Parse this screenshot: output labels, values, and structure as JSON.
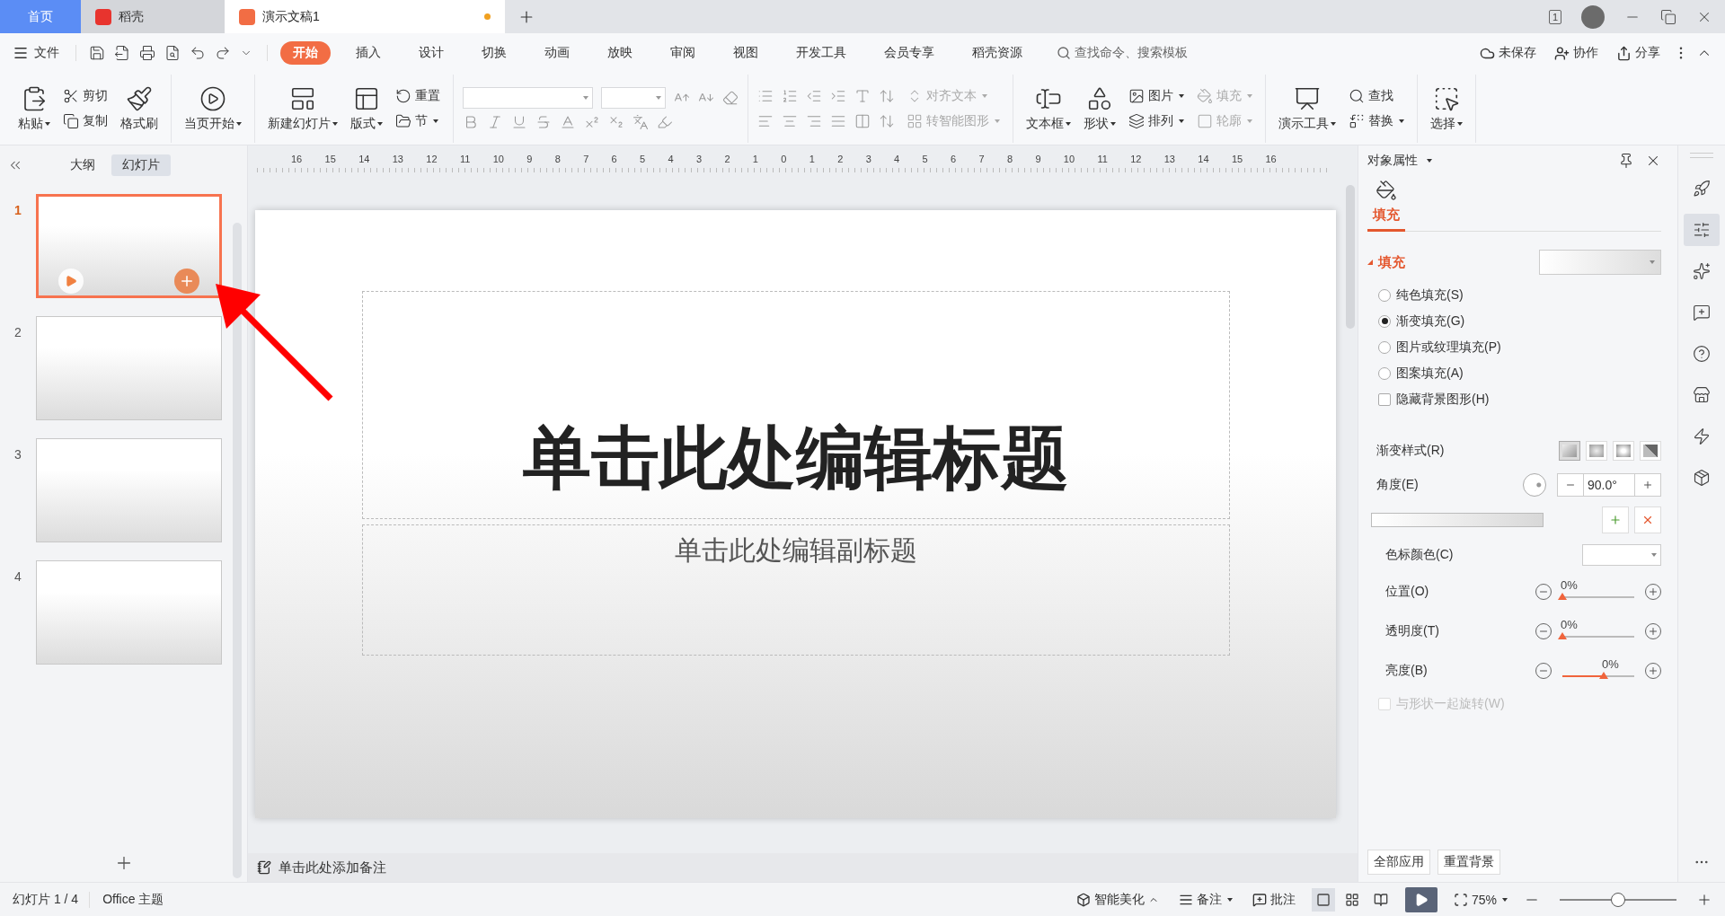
{
  "title_bar": {
    "tabs": [
      {
        "label": "首页",
        "kind": "home",
        "selected": false
      },
      {
        "label": "稻壳",
        "kind": "app",
        "selected": false
      },
      {
        "label": "演示文稿1",
        "kind": "doc",
        "selected": true,
        "modified": true
      }
    ],
    "device_badge": "1"
  },
  "menu_bar": {
    "file": "文件",
    "tabs": [
      {
        "label": "开始",
        "selected": true
      },
      {
        "label": "插入",
        "selected": false
      },
      {
        "label": "设计",
        "selected": false
      },
      {
        "label": "切换",
        "selected": false
      },
      {
        "label": "动画",
        "selected": false
      },
      {
        "label": "放映",
        "selected": false
      },
      {
        "label": "审阅",
        "selected": false
      },
      {
        "label": "视图",
        "selected": false
      },
      {
        "label": "开发工具",
        "selected": false
      },
      {
        "label": "会员专享",
        "selected": false
      },
      {
        "label": "稻壳资源",
        "selected": false
      }
    ],
    "search": {
      "placeholder": "查找命令、搜索模板"
    },
    "actions": [
      "未保存",
      "协作",
      "分享"
    ]
  },
  "ribbon": {
    "paste": {
      "label": "粘贴",
      "dropdown": true,
      "disabled": false
    },
    "cut": {
      "label": "剪切",
      "dropdown": false,
      "disabled": false
    },
    "copy": {
      "label": "复制",
      "dropdown": false,
      "disabled": false
    },
    "format_painter": {
      "label": "格式刷",
      "dropdown": false,
      "disabled": false
    },
    "play_current": {
      "label": "当页开始",
      "dropdown": true,
      "disabled": false
    },
    "new_slide": {
      "label": "新建幻灯片",
      "dropdown": true,
      "disabled": false
    },
    "layout": {
      "label": "版式",
      "dropdown": true,
      "disabled": false
    },
    "reset": {
      "label": "重置",
      "dropdown": false,
      "disabled": false
    },
    "section": {
      "label": "节",
      "dropdown": true,
      "disabled": false
    },
    "align_text": {
      "label": "对齐文本",
      "dropdown": true,
      "disabled": true
    },
    "smart_art": {
      "label": "转智能图形",
      "dropdown": true,
      "disabled": true
    },
    "text_box": {
      "label": "文本框",
      "dropdown": true,
      "disabled": false
    },
    "shape": {
      "label": "形状",
      "dropdown": true,
      "disabled": false
    },
    "picture": {
      "label": "图片",
      "dropdown": true,
      "disabled": false
    },
    "arrange": {
      "label": "排列",
      "dropdown": true,
      "disabled": false
    },
    "fill": {
      "label": "填充",
      "dropdown": true,
      "disabled": true
    },
    "outline": {
      "label": "轮廓",
      "dropdown": true,
      "disabled": true
    },
    "tools": {
      "label": "演示工具",
      "dropdown": true,
      "disabled": false
    },
    "find": {
      "label": "查找",
      "dropdown": false,
      "disabled": false
    },
    "replace": {
      "label": "替换",
      "dropdown": true,
      "disabled": false
    },
    "select": {
      "label": "选择",
      "dropdown": true,
      "disabled": false
    }
  },
  "slide_panel": {
    "views": [
      {
        "label": "大纲",
        "selected": false
      },
      {
        "label": "幻灯片",
        "selected": true
      }
    ],
    "slides": [
      {
        "number": "1",
        "selected": true
      },
      {
        "number": "2",
        "selected": false
      },
      {
        "number": "3",
        "selected": false
      },
      {
        "number": "4",
        "selected": false
      }
    ]
  },
  "ruler": [
    "16",
    "15",
    "14",
    "13",
    "12",
    "11",
    "10",
    "9",
    "8",
    "7",
    "6",
    "5",
    "4",
    "3",
    "2",
    "1",
    "0",
    "1",
    "2",
    "3",
    "4",
    "5",
    "6",
    "7",
    "8",
    "9",
    "10",
    "11",
    "12",
    "13",
    "14",
    "15",
    "16"
  ],
  "slide": {
    "title": "单击此处编辑标题",
    "subtitle": "单击此处编辑副标题"
  },
  "notes": {
    "placeholder": "单击此处添加备注"
  },
  "properties": {
    "title": "对象属性",
    "tab": {
      "label": "填充",
      "selected": true
    },
    "section": "填充",
    "options": [
      {
        "label": "纯色填充(S)",
        "kind": "radio",
        "selected": false
      },
      {
        "label": "渐变填充(G)",
        "kind": "radio",
        "selected": true
      },
      {
        "label": "图片或纹理填充(P)",
        "kind": "radio",
        "selected": false
      },
      {
        "label": "图案填充(A)",
        "kind": "radio",
        "selected": false
      },
      {
        "label": "隐藏背景图形(H)",
        "kind": "checkbox",
        "checked": false
      }
    ],
    "gradient_style": {
      "label": "渐变样式(R)",
      "styles": [
        {
          "selected": true
        },
        {
          "selected": false
        },
        {
          "selected": false
        },
        {
          "selected": false
        }
      ]
    },
    "angle": {
      "label": "角度(E)",
      "value": "90.0°"
    },
    "stop_color": {
      "label": "色标颜色(C)"
    },
    "sliders": [
      {
        "label": "位置(O)",
        "level": 0,
        "reading": "0%"
      },
      {
        "label": "透明度(T)",
        "level": 0,
        "reading": "0%"
      },
      {
        "label": "亮度(B)",
        "level": 0.5,
        "reading": "0%"
      }
    ],
    "rotate": {
      "label": "与形状一起旋转(W)",
      "checked": false,
      "disabled": true
    },
    "buttons": [
      "全部应用",
      "重置背景"
    ]
  },
  "status_bar": {
    "slide": "幻灯片 1 / 4",
    "theme": "Office 主题",
    "beautify": "智能美化",
    "notes": "备注",
    "comment": "批注",
    "views": [
      {
        "selected": true
      },
      {
        "selected": false
      },
      {
        "selected": false
      }
    ],
    "zoom": "75%",
    "zoom_level": {
      "level": 0.5
    }
  }
}
